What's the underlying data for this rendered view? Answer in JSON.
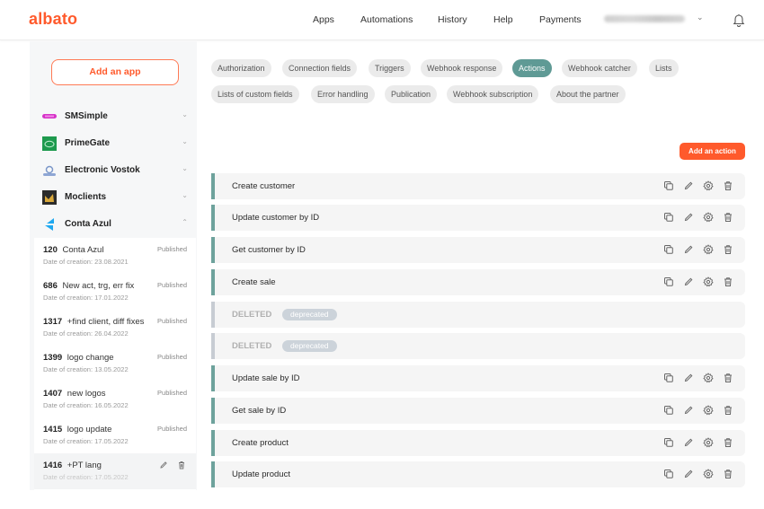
{
  "header": {
    "logo": "albato",
    "nav": [
      "Apps",
      "Automations",
      "History",
      "Help",
      "Payments"
    ],
    "user_email": "[blurred email]"
  },
  "sidebar": {
    "add_app_label": "Add an app",
    "apps": [
      {
        "name": "SMSimple",
        "icon": "smsimple-logo-icon",
        "expanded": false
      },
      {
        "name": "PrimeGate",
        "icon": "primegate-logo-icon",
        "expanded": false
      },
      {
        "name": "Electronic Vostok",
        "icon": "electronic-vostok-logo-icon",
        "expanded": false
      },
      {
        "name": "Moclients",
        "icon": "moclients-logo-icon",
        "expanded": false
      },
      {
        "name": "Conta Azul",
        "icon": "conta-azul-logo-icon",
        "expanded": true
      }
    ],
    "versions": [
      {
        "id": "120",
        "title": "Conta Azul",
        "date": "Date of creation: 23.08.2021",
        "status": "Published"
      },
      {
        "id": "686",
        "title": "New act, trg, err fix",
        "date": "Date of creation: 17.01.2022",
        "status": "Published"
      },
      {
        "id": "1317",
        "title": "+find client, diff fixes",
        "date": "Date of creation: 26.04.2022",
        "status": "Published"
      },
      {
        "id": "1399",
        "title": "logo change",
        "date": "Date of creation: 13.05.2022",
        "status": "Published"
      },
      {
        "id": "1407",
        "title": "new logos",
        "date": "Date of creation: 16.05.2022",
        "status": "Published"
      },
      {
        "id": "1415",
        "title": "logo update",
        "date": "Date of creation: 17.05.2022",
        "status": "Published"
      },
      {
        "id": "1416",
        "title": "+PT lang",
        "date": "Date of creation: 17.05.2022",
        "status": ""
      }
    ]
  },
  "tabs": [
    {
      "label": "Authorization",
      "active": false
    },
    {
      "label": "Connection fields",
      "active": false
    },
    {
      "label": "Triggers",
      "active": false
    },
    {
      "label": "Webhook response",
      "active": false
    },
    {
      "label": "Actions",
      "active": true
    },
    {
      "label": "Webhook catcher",
      "active": false
    },
    {
      "label": "Lists",
      "active": false
    },
    {
      "label": "Lists of custom fields",
      "active": false
    },
    {
      "label": "Error handling",
      "active": false
    },
    {
      "label": "Publication",
      "active": false
    },
    {
      "label": "Webhook subscription",
      "active": false
    },
    {
      "label": "About the partner",
      "active": false
    }
  ],
  "add_action_label": "Add an action",
  "actions": [
    {
      "name": "Create customer",
      "deleted": false
    },
    {
      "name": "Update customer by ID",
      "deleted": false
    },
    {
      "name": "Get customer by ID",
      "deleted": false
    },
    {
      "name": "Create sale",
      "deleted": false
    },
    {
      "name": "DELETED",
      "deleted": true,
      "badge": "deprecated"
    },
    {
      "name": "DELETED",
      "deleted": true,
      "badge": "deprecated"
    },
    {
      "name": "Update sale by ID",
      "deleted": false
    },
    {
      "name": "Get sale by ID",
      "deleted": false
    },
    {
      "name": "Create product",
      "deleted": false
    },
    {
      "name": "Update product",
      "deleted": false
    }
  ],
  "colors": {
    "brand": "#ff5a2c",
    "accent": "#5f9a95",
    "row_marker": "#6ea29c",
    "deleted_marker": "#c7ccd3"
  }
}
